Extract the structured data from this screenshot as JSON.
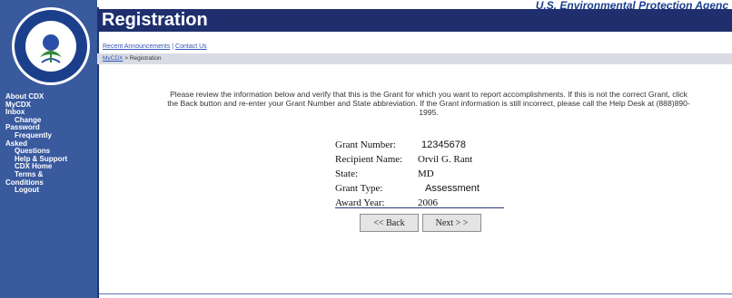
{
  "header": {
    "agency_name": "U.S. Environmental Protection Agenc",
    "page_title": "Registration"
  },
  "subnav": {
    "links": [
      "Recent Announcements",
      "Contact Us"
    ],
    "separator": " | "
  },
  "breadcrumb": {
    "link": "MyCDX",
    "separator": " > ",
    "current": "Registration"
  },
  "sidebar": {
    "items": [
      {
        "label": "About CDX",
        "indent": false
      },
      {
        "label": "MyCDX",
        "indent": false
      },
      {
        "label": "Inbox",
        "indent": false
      },
      {
        "label": "Change",
        "indent": true
      },
      {
        "label": "Password",
        "indent": false
      },
      {
        "label": "Frequently",
        "indent": true
      },
      {
        "label": "Asked",
        "indent": false
      },
      {
        "label": "Questions",
        "indent": true
      },
      {
        "label": "Help & Support",
        "indent": true
      },
      {
        "label": "CDX Home",
        "indent": true
      },
      {
        "label": "Terms &",
        "indent": true
      },
      {
        "label": "Conditions",
        "indent": false
      },
      {
        "label": "Logout",
        "indent": true
      }
    ]
  },
  "instructions": {
    "line1": "Please review the information below and verify that this is the Grant for which you want to report accomplishments. If this is not the correct Grant, click",
    "line2": "the Back button and re-enter your Grant Number and State abbreviation. If the Grant information is still incorrect, please call the Help Desk at (888)890-",
    "line3": "1995."
  },
  "grant": {
    "number_label": "Grant Number:",
    "number": "12345678",
    "recipient_label": "Recipient Name:",
    "recipient": "Orvil G. Rant",
    "state_label": "State:",
    "state": "MD",
    "type_label": "Grant Type:",
    "type": "Assessment",
    "year_label": "Award Year:",
    "year": "2006"
  },
  "buttons": {
    "back": "<< Back",
    "next": "Next > >"
  },
  "colors": {
    "sidebar": "#3a5a9e",
    "title_bar": "#1f2f6e",
    "agency_text": "#1c3f8c",
    "link": "#3355bb"
  }
}
